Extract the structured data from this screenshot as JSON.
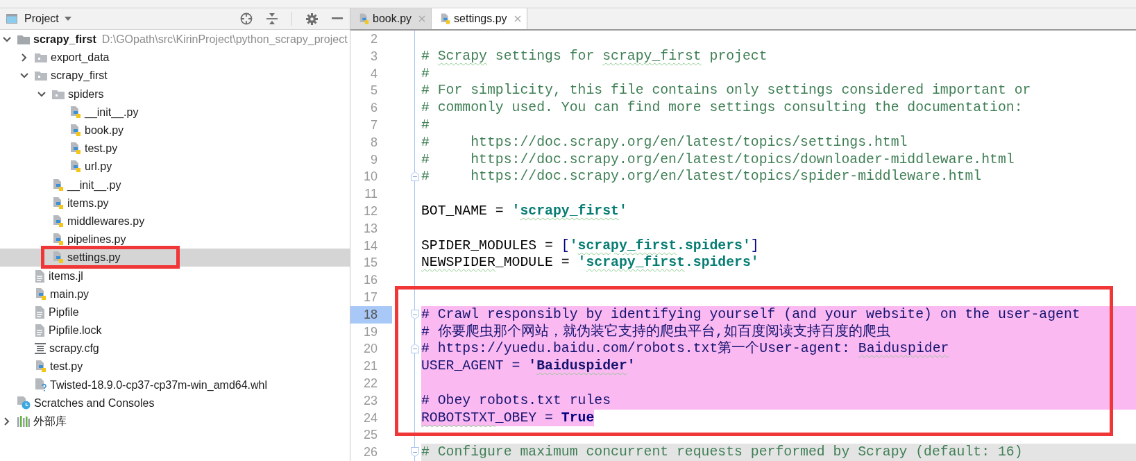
{
  "project_panel": {
    "title": "Project",
    "tree": [
      {
        "label": "scrapy_first",
        "kind": "project",
        "path": "D:\\GOpath\\src\\KirinProject\\python_scrapy_project",
        "expanded": true,
        "selected": false,
        "children": [
          {
            "label": "export_data",
            "kind": "folder",
            "expanded": false,
            "selected": false
          },
          {
            "label": "scrapy_first",
            "kind": "folder",
            "expanded": true,
            "selected": false,
            "children": [
              {
                "label": "spiders",
                "kind": "folder",
                "expanded": true,
                "selected": false,
                "children": [
                  {
                    "label": "__init__.py",
                    "kind": "python",
                    "selected": false
                  },
                  {
                    "label": "book.py",
                    "kind": "python",
                    "selected": false
                  },
                  {
                    "label": "test.py",
                    "kind": "python",
                    "selected": false
                  },
                  {
                    "label": "url.py",
                    "kind": "python",
                    "selected": false
                  }
                ]
              },
              {
                "label": "__init__.py",
                "kind": "python",
                "selected": false
              },
              {
                "label": "items.py",
                "kind": "python",
                "selected": false
              },
              {
                "label": "middlewares.py",
                "kind": "python",
                "selected": false
              },
              {
                "label": "pipelines.py",
                "kind": "python",
                "selected": false
              },
              {
                "label": "settings.py",
                "kind": "python",
                "selected": true
              }
            ]
          },
          {
            "label": "items.jl",
            "kind": "text",
            "selected": false
          },
          {
            "label": "main.py",
            "kind": "python",
            "selected": false
          },
          {
            "label": "Pipfile",
            "kind": "text",
            "selected": false
          },
          {
            "label": "Pipfile.lock",
            "kind": "text",
            "selected": false
          },
          {
            "label": "scrapy.cfg",
            "kind": "config",
            "selected": false
          },
          {
            "label": "test.py",
            "kind": "python",
            "selected": false
          },
          {
            "label": "Twisted-18.9.0-cp37-cp37m-win_amd64.whl",
            "kind": "unknown",
            "selected": false
          }
        ]
      },
      {
        "label": "Scratches and Consoles",
        "kind": "scratches",
        "selected": false
      },
      {
        "label": "外部库",
        "kind": "library",
        "expanded": false,
        "selected": false
      }
    ]
  },
  "editor": {
    "tabs": [
      {
        "label": "book.py",
        "selected": false
      },
      {
        "label": "settings.py",
        "selected": true
      }
    ],
    "lines": [
      {
        "number": "2",
        "kind": "plain",
        "current": false,
        "fold_start": false,
        "fold_end": false
      },
      {
        "number": "3",
        "kind": "plain",
        "current": false,
        "fold_start": false,
        "fold_end": false,
        "segments": [
          {
            "kind": "comment",
            "text": "# "
          },
          {
            "kind": "comment",
            "text": "Scrapy",
            "spell_warning": true
          },
          {
            "kind": "comment",
            "text": " settings for "
          },
          {
            "kind": "comment",
            "text": "scrapy_first",
            "spell_warning": true
          },
          {
            "kind": "comment",
            "text": " project"
          }
        ]
      },
      {
        "number": "4",
        "kind": "plain",
        "current": false,
        "fold_start": false,
        "fold_end": false,
        "segments": [
          {
            "kind": "comment",
            "text": "#"
          }
        ]
      },
      {
        "number": "5",
        "kind": "plain",
        "current": false,
        "fold_start": false,
        "fold_end": false,
        "segments": [
          {
            "kind": "comment",
            "text": "# For simplicity, this file contains only settings considered important or"
          }
        ]
      },
      {
        "number": "6",
        "kind": "plain",
        "current": false,
        "fold_start": false,
        "fold_end": false,
        "segments": [
          {
            "kind": "comment",
            "text": "# commonly used. You can find more settings consulting the documentation:"
          }
        ]
      },
      {
        "number": "7",
        "kind": "plain",
        "current": false,
        "fold_start": false,
        "fold_end": false,
        "segments": [
          {
            "kind": "comment",
            "text": "#"
          }
        ]
      },
      {
        "number": "8",
        "kind": "plain",
        "current": false,
        "fold_start": false,
        "fold_end": false,
        "segments": [
          {
            "kind": "comment",
            "text": "#     https://doc.scrapy.org/en/latest/topics/settings.html"
          }
        ]
      },
      {
        "number": "9",
        "kind": "plain",
        "current": false,
        "fold_start": false,
        "fold_end": false,
        "segments": [
          {
            "kind": "comment",
            "text": "#     https://doc.scrapy.org/en/latest/topics/downloader-middleware.html"
          }
        ]
      },
      {
        "number": "10",
        "kind": "plain",
        "current": false,
        "fold_start": false,
        "fold_end": true,
        "segments": [
          {
            "kind": "comment",
            "text": "#     https://doc.scrapy.org/en/latest/topics/spider-middleware.html"
          }
        ]
      },
      {
        "number": "11",
        "kind": "plain",
        "current": false,
        "fold_start": false,
        "fold_end": false
      },
      {
        "number": "12",
        "kind": "plain",
        "current": false,
        "fold_start": false,
        "fold_end": false,
        "segments": [
          {
            "kind": "code",
            "text": "BOT_NAME = "
          },
          {
            "kind": "string",
            "text": "'"
          },
          {
            "kind": "string",
            "text": "scrapy_first",
            "spell_warning": true
          },
          {
            "kind": "string",
            "text": "'"
          }
        ]
      },
      {
        "number": "13",
        "kind": "plain",
        "current": false,
        "fold_start": false,
        "fold_end": false
      },
      {
        "number": "14",
        "kind": "plain",
        "current": false,
        "fold_start": false,
        "fold_end": false,
        "segments": [
          {
            "kind": "code",
            "text": "SPIDER_MODULES = "
          },
          {
            "kind": "bracket",
            "text": "["
          },
          {
            "kind": "string",
            "text": "'"
          },
          {
            "kind": "string",
            "text": "scrapy_first",
            "spell_warning": true
          },
          {
            "kind": "string",
            "text": ".spiders'"
          },
          {
            "kind": "bracket",
            "text": "]"
          }
        ]
      },
      {
        "number": "15",
        "kind": "plain",
        "current": false,
        "fold_start": false,
        "fold_end": false,
        "segments": [
          {
            "kind": "code",
            "text": "NEWSPIDER",
            "spell_warning": true
          },
          {
            "kind": "code",
            "text": "_MODULE = "
          },
          {
            "kind": "string",
            "text": "'"
          },
          {
            "kind": "string",
            "text": "scrapy_first",
            "spell_warning": true
          },
          {
            "kind": "string",
            "text": ".spiders'"
          }
        ]
      },
      {
        "number": "16",
        "kind": "plain",
        "current": false,
        "fold_start": false,
        "fold_end": false
      },
      {
        "number": "17",
        "kind": "plain",
        "current": false,
        "fold_start": false,
        "fold_end": false
      },
      {
        "number": "18",
        "kind": "marked",
        "current": true,
        "fold_start": true,
        "fold_end": false,
        "segments": [
          {
            "kind": "comment",
            "text": "# Crawl responsibly by identifying yourself (and your website) on the user-agent"
          }
        ]
      },
      {
        "number": "19",
        "kind": "marked",
        "current": false,
        "fold_start": false,
        "fold_end": false,
        "segments": [
          {
            "kind": "comment",
            "text": "# 你要爬虫那个网站，就伪装它支持的爬虫平台,如百度阅读支持百度的爬虫"
          }
        ]
      },
      {
        "number": "20",
        "kind": "marked",
        "current": false,
        "fold_start": false,
        "fold_end": true,
        "segments": [
          {
            "kind": "comment",
            "text": "# https://yuedu.baidu.com/robots.txt第一个User-agent: "
          },
          {
            "kind": "comment",
            "text": "Baiduspider",
            "spell_warning": true
          }
        ]
      },
      {
        "number": "21",
        "kind": "marked",
        "current": false,
        "fold_start": false,
        "fold_end": false,
        "segments": [
          {
            "kind": "code",
            "text": "USER_AGENT = "
          },
          {
            "kind": "string",
            "text": "'"
          },
          {
            "kind": "string",
            "text": "Baiduspider",
            "spell_warning": true
          },
          {
            "kind": "string",
            "text": "'"
          }
        ]
      },
      {
        "number": "22",
        "kind": "marked",
        "current": false,
        "fold_start": false,
        "fold_end": false
      },
      {
        "number": "23",
        "kind": "marked",
        "current": false,
        "fold_start": false,
        "fold_end": false,
        "segments": [
          {
            "kind": "comment",
            "text": "# Obey robots.txt rules"
          }
        ]
      },
      {
        "number": "24",
        "kind": "marktail",
        "current": false,
        "fold_start": false,
        "fold_end": false,
        "segments": [
          {
            "kind": "code",
            "text": "ROBOTSTXT",
            "spell_warning": true
          },
          {
            "kind": "code",
            "text": "_OBEY = "
          },
          {
            "kind": "keyword",
            "text": "True"
          }
        ]
      },
      {
        "number": "25",
        "kind": "plain",
        "current": false,
        "fold_start": false,
        "fold_end": false
      },
      {
        "number": "26",
        "kind": "shaded",
        "current": false,
        "fold_start": true,
        "fold_end": false,
        "segments": [
          {
            "kind": "comment",
            "text": "# Configure maximum concurrent requests performed by Scrapy (default: 16)"
          }
        ]
      }
    ]
  }
}
